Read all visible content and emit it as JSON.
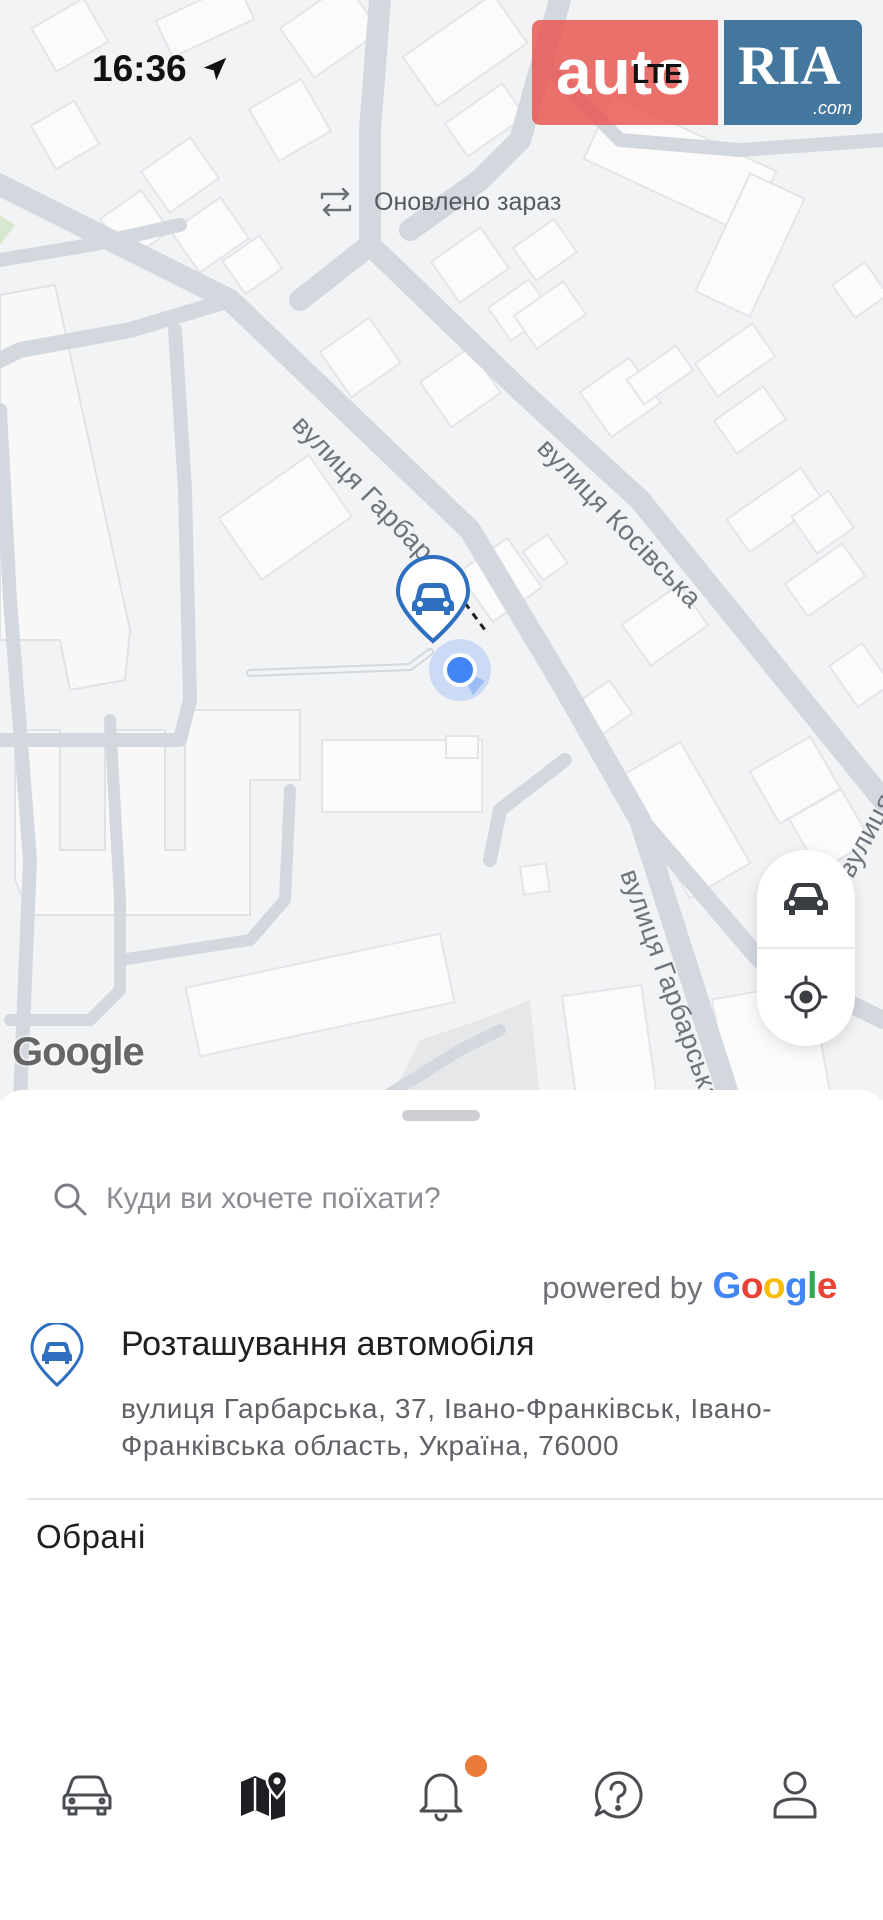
{
  "status_bar": {
    "time": "16:36"
  },
  "watermark": {
    "auto": "auto",
    "ria": "RIA",
    "com": ".com",
    "lte": "LTE"
  },
  "map": {
    "updated_text": "Оновлено зараз",
    "streets": [
      "вулиця Гарбарська",
      "вулиця Косівська",
      "вулиця Гарбарська",
      "вулиця Ма"
    ],
    "google_logo": "Google",
    "controls": {
      "vehicle_icon": "car-icon",
      "locate_icon": "crosshair-icon"
    }
  },
  "sheet": {
    "search_placeholder": "Куди ви хочете поїхати?",
    "powered_by": "powered by",
    "google": "Google",
    "vehicle_location": {
      "title": "Розташування автомобіля",
      "address": "вулиця Гарбарська, 37, Івано-Франківськ, Івано-Франківська область, Україна, 76000"
    },
    "favorites_title": "Обрані"
  },
  "tabbar": {
    "tabs": [
      {
        "name": "vehicles",
        "icon": "car-outline-icon",
        "active": false
      },
      {
        "name": "map",
        "icon": "map-pin-icon",
        "active": true
      },
      {
        "name": "notifications",
        "icon": "bell-icon",
        "active": false,
        "has_badge": true
      },
      {
        "name": "help",
        "icon": "question-bubble-icon",
        "active": false
      },
      {
        "name": "profile",
        "icon": "person-icon",
        "active": false
      }
    ]
  },
  "colors": {
    "accent_blue": "#2f6fbf",
    "user_dot": "#4285f4",
    "badge": "#ec7a3a",
    "map_bg": "#f2f3f5",
    "road": "#d3d8df"
  }
}
